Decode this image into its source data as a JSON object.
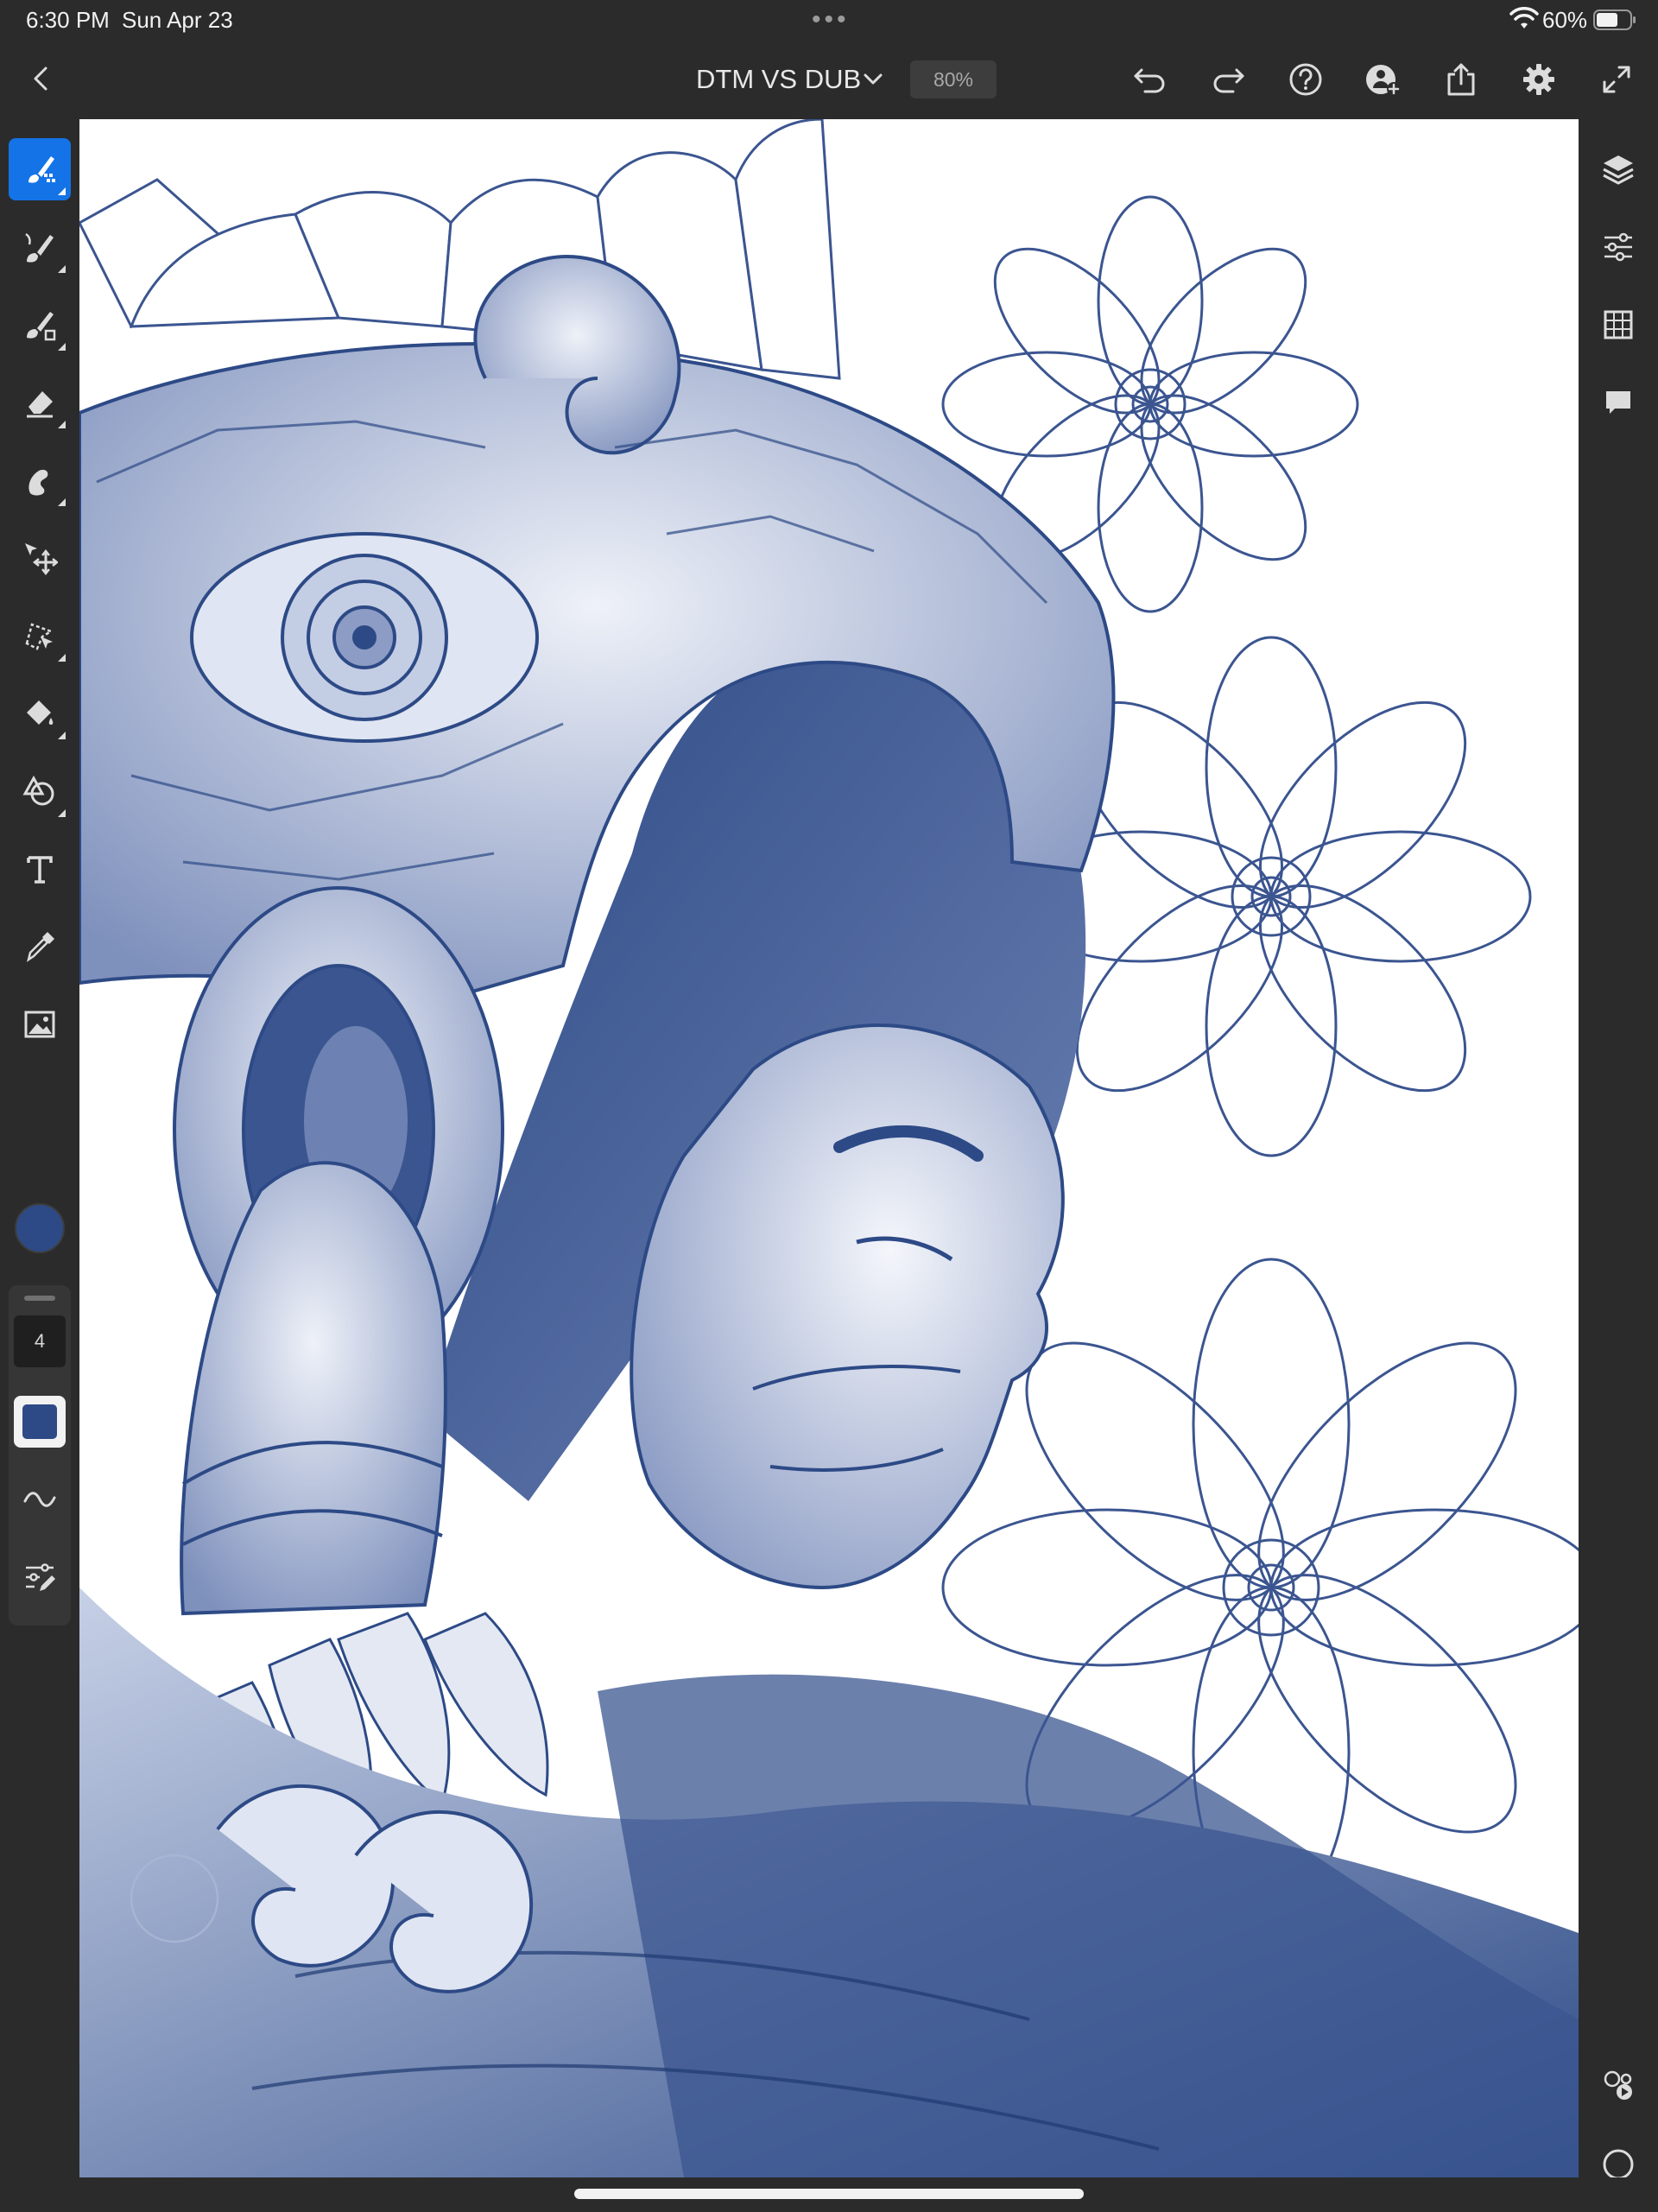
{
  "status_bar": {
    "time": "6:30 PM",
    "date": "Sun Apr 23",
    "battery": "60%",
    "dots": "•••"
  },
  "header": {
    "doc_title": "DTM VS DUB",
    "zoom": "80%"
  },
  "brush": {
    "size": "4",
    "color": "#2d4a86"
  },
  "colors": {
    "accent": "#1473e6",
    "ink": "#2d4a86",
    "chrome": "#2b2b2b"
  },
  "toolbar_left": [
    "pixel-brush-icon",
    "live-brush-icon",
    "vector-brush-icon",
    "eraser-icon",
    "smudge-icon",
    "transform-icon",
    "selection-icon",
    "fill-icon",
    "shape-icon",
    "text-icon",
    "eyedropper-icon",
    "image-icon"
  ],
  "toolbar_right": [
    "layers-icon",
    "layer-properties-icon",
    "grid-icon",
    "comments-icon",
    "share-collaborate-icon",
    "circle-icon"
  ]
}
